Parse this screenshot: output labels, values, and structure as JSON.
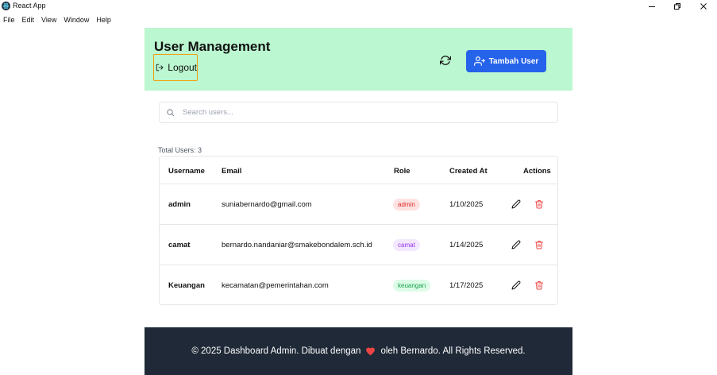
{
  "window": {
    "title": "React App",
    "icons": [
      "minimize-icon",
      "restore-icon",
      "close-icon"
    ]
  },
  "menu": {
    "items": [
      "File",
      "Edit",
      "View",
      "Window",
      "Help"
    ]
  },
  "header": {
    "title": "User Management",
    "logout_label": "Logout",
    "add_label": "Tambah User",
    "bg_color": "#bbf7d0",
    "accent_color": "#2563eb"
  },
  "search": {
    "placeholder": "Search users...",
    "value": ""
  },
  "summary": {
    "total_label": "Total Users: 3"
  },
  "table": {
    "columns": [
      "Username",
      "Email",
      "Role",
      "Created At",
      "Actions"
    ],
    "rows": [
      {
        "username": "admin",
        "email": "suniabernardo@gmail.com",
        "role": "admin",
        "role_color": "#dc2626",
        "role_bg": "#fee2e2",
        "created": "1/10/2025"
      },
      {
        "username": "camat",
        "email": "bernardo.nandaniar@smakebondalem.sch.id",
        "role": "camat",
        "role_color": "#9333ea",
        "role_bg": "#f3e8ff",
        "created": "1/14/2025"
      },
      {
        "username": "Keuangan",
        "email": "kecamatan@pemerintahan.com",
        "role": "keuangan",
        "role_color": "#16a34a",
        "role_bg": "#dcfce7",
        "created": "1/17/2025"
      }
    ]
  },
  "footer": {
    "text_before": "© 2025 Dashboard Admin. Dibuat dengan",
    "text_after": "oleh Bernardo. All Rights Reserved.",
    "heart_color": "#ef4444"
  }
}
